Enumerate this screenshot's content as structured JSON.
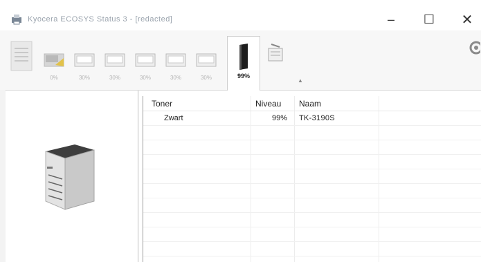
{
  "window": {
    "title": "Kyocera ECOSYS Status 3 - [redacted]",
    "minimize_label": "–",
    "maximize_label": "☐",
    "close_label": "✕"
  },
  "toolbar": {
    "trays": [
      {
        "label": "0%"
      },
      {
        "label": "30%"
      },
      {
        "label": "30%"
      },
      {
        "label": "30%"
      },
      {
        "label": "30%"
      },
      {
        "label": "30%"
      }
    ],
    "toner_tab_label": "99%",
    "collapse_label": "▲"
  },
  "table": {
    "headers": {
      "toner": "Toner",
      "niveau": "Niveau",
      "naam": "Naam"
    },
    "rows": [
      {
        "toner": "Zwart",
        "niveau": "99%",
        "naam": "TK-3190S"
      }
    ]
  },
  "colors": {
    "toolbar_bg": "#f7f7f7",
    "tray_yellow": "#e2c24a",
    "text": "#222222"
  }
}
